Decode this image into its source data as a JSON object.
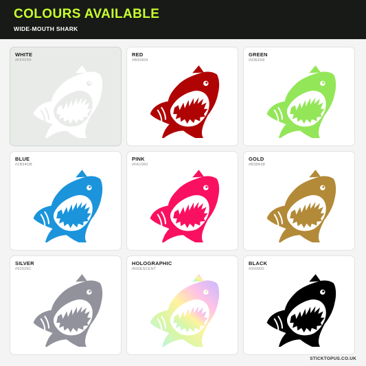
{
  "header": {
    "title": "COLOURS AVAILABLE",
    "subtitle": "WIDE-MOUTH SHARK"
  },
  "colors": [
    {
      "name": "WHITE",
      "code": "#FFFFFF",
      "color": "#FFFFFF"
    },
    {
      "name": "RED",
      "code": "#B00404",
      "color": "#B00404"
    },
    {
      "name": "GREEN",
      "code": "#93E658",
      "color": "#93E658"
    },
    {
      "name": "BLUE",
      "code": "#1B94DB",
      "color": "#1B94DB"
    },
    {
      "name": "PINK",
      "code": "#FA1060",
      "color": "#FA1060"
    },
    {
      "name": "GOLD",
      "code": "#B38A38",
      "color": "#B38A38"
    },
    {
      "name": "SILVER",
      "code": "#92929C",
      "color": "#92929C"
    },
    {
      "name": "HOLOGRAPHIC",
      "code": "IRIDESCENT",
      "color": "holographic"
    },
    {
      "name": "BLACK",
      "code": "#000000",
      "color": "#000000"
    }
  ],
  "selected_index": 0,
  "footer": {
    "site": "STICKTOPUS.CO.UK"
  }
}
